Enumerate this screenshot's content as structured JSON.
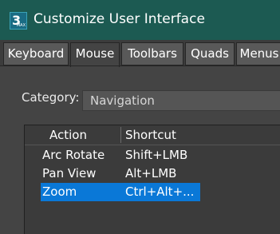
{
  "window": {
    "title": "Customize User Interface",
    "app_icon_number": "3",
    "app_icon_sub": "MAX"
  },
  "tabs": [
    {
      "label": "Keyboard",
      "active": false
    },
    {
      "label": "Mouse",
      "active": true
    },
    {
      "label": "Toolbars",
      "active": false
    },
    {
      "label": "Quads",
      "active": false
    },
    {
      "label": "Menus",
      "active": false
    }
  ],
  "category": {
    "label": "Category:",
    "value": "Navigation"
  },
  "table": {
    "columns": [
      "Action",
      "Shortcut"
    ],
    "rows": [
      {
        "action": "Arc Rotate",
        "shortcut": "Shift+LMB",
        "selected": false
      },
      {
        "action": "Pan View",
        "shortcut": "Alt+LMB",
        "selected": false
      },
      {
        "action": "Zoom",
        "shortcut": "Ctrl+Alt+...",
        "selected": true
      }
    ]
  },
  "colors": {
    "titlebar": "#1c5a52",
    "selection": "#0a78d7",
    "panel": "#444444"
  }
}
